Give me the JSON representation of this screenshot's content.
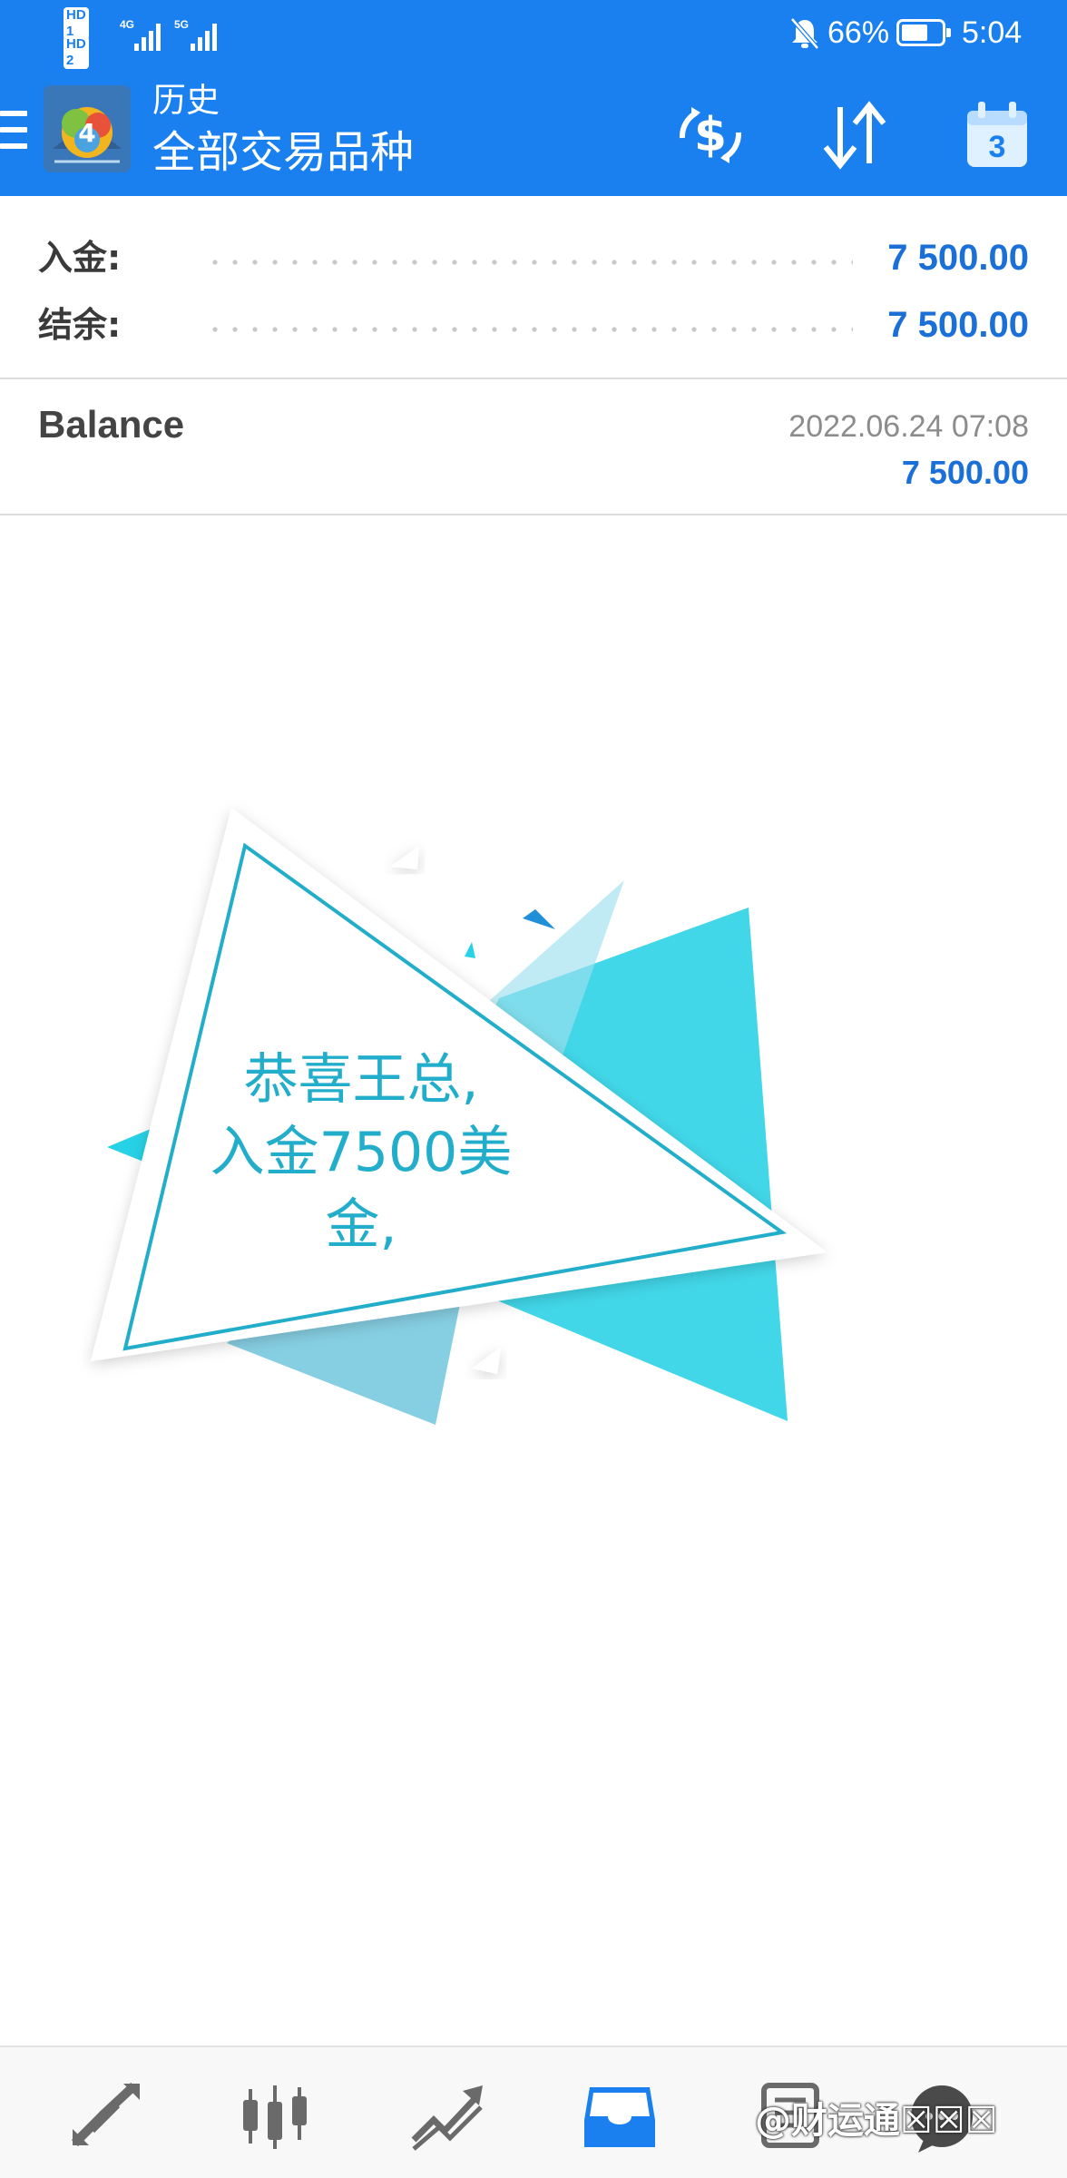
{
  "status_bar": {
    "sim1_label": "HD 1",
    "sim2_label": "HD 2",
    "network1": "4G",
    "network2": "5G",
    "battery_percent": "66%",
    "battery_level": 0.66,
    "time": "5:04"
  },
  "app_bar": {
    "title": "历史",
    "subtitle": "全部交易品种",
    "calendar_day": "3",
    "icons": [
      "menu-icon",
      "app-logo",
      "currency-swap-icon",
      "sort-icon",
      "calendar-icon"
    ]
  },
  "summary": {
    "deposit_label": "入金:",
    "deposit_value": "7 500.00",
    "balance_label": "结余:",
    "balance_value": "7 500.00"
  },
  "deals": [
    {
      "type": "Balance",
      "time": "2022.06.24 07:08",
      "amount": "7 500.00"
    }
  ],
  "greeting": {
    "line1": "恭喜王总,",
    "line2": "入金7500美",
    "line3": "金,"
  },
  "bottom_nav": {
    "items": [
      "quotes-icon",
      "chart-icon",
      "trade-icon",
      "history-icon",
      "news-icon",
      "chat-icon"
    ],
    "active": "history-icon",
    "watermark": "@财运通☒☒☒"
  },
  "colors": {
    "primary": "#1a7fef",
    "value_blue": "#1a70d6",
    "triangle_cyan": "#27d2e6",
    "text_cyan": "#22aecb"
  }
}
